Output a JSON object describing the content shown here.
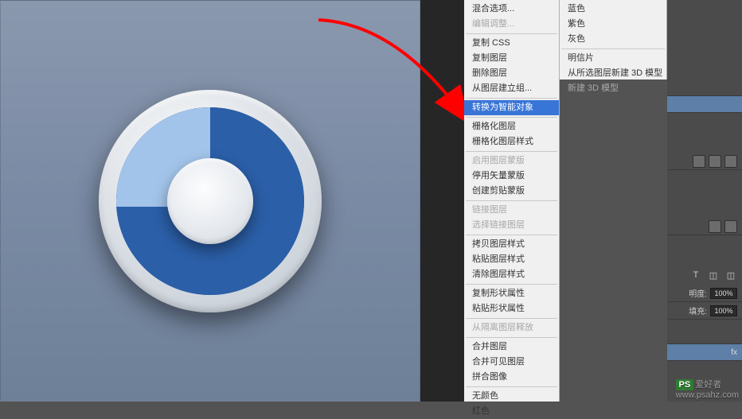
{
  "icon_semantics": {
    "outer_ring": "bezel-ring",
    "inner_disc": "pie-disc",
    "hub": "center-hub"
  },
  "menu": {
    "section1": [
      {
        "label": "混合选项...",
        "disabled": false
      },
      {
        "label": "编辑调整...",
        "disabled": true
      }
    ],
    "section2": [
      {
        "label": "复制 CSS",
        "disabled": false
      },
      {
        "label": "复制图层",
        "disabled": false
      },
      {
        "label": "删除图层",
        "disabled": false
      },
      {
        "label": "从图层建立组...",
        "disabled": false
      }
    ],
    "smart_object": "转换为智能对象",
    "section3": [
      {
        "label": "栅格化图层",
        "disabled": false
      },
      {
        "label": "栅格化图层样式",
        "disabled": false
      }
    ],
    "section4": [
      {
        "label": "启用图层蒙版",
        "disabled": true
      },
      {
        "label": "停用矢量蒙版",
        "disabled": false
      },
      {
        "label": "创建剪贴蒙版",
        "disabled": false
      }
    ],
    "section5": [
      {
        "label": "链接图层",
        "disabled": true
      },
      {
        "label": "选择链接图层",
        "disabled": true
      }
    ],
    "section6": [
      {
        "label": "拷贝图层样式",
        "disabled": false
      },
      {
        "label": "粘贴图层样式",
        "disabled": false
      },
      {
        "label": "清除图层样式",
        "disabled": false
      }
    ],
    "section7": [
      {
        "label": "复制形状属性",
        "disabled": false
      },
      {
        "label": "粘贴形状属性",
        "disabled": false
      }
    ],
    "section8": [
      {
        "label": "从隔离图层释放",
        "disabled": true
      }
    ],
    "section9": [
      {
        "label": "合并图层",
        "disabled": false
      },
      {
        "label": "合并可见图层",
        "disabled": false
      },
      {
        "label": "拼合图像",
        "disabled": false
      }
    ],
    "section10": [
      {
        "label": "无颜色",
        "disabled": false
      },
      {
        "label": "红色",
        "disabled": false
      }
    ]
  },
  "submenu": {
    "section1": [
      {
        "label": "蓝色",
        "disabled": false
      },
      {
        "label": "紫色",
        "disabled": false
      },
      {
        "label": "灰色",
        "disabled": false
      }
    ],
    "section2": [
      {
        "label": "明信片",
        "disabled": false
      },
      {
        "label": "从所选图层新建 3D 模型",
        "disabled": false
      },
      {
        "label": "新建 3D 模型",
        "disabled": true
      }
    ]
  },
  "panel": {
    "opacity_label": "明度:",
    "opacity_value": "100%",
    "fill_label": "填充:",
    "fill_value": "100%",
    "fx_label": "fx"
  },
  "watermark": {
    "logo": "PS",
    "text": "爱好者",
    "url": "www.psahz.com"
  }
}
